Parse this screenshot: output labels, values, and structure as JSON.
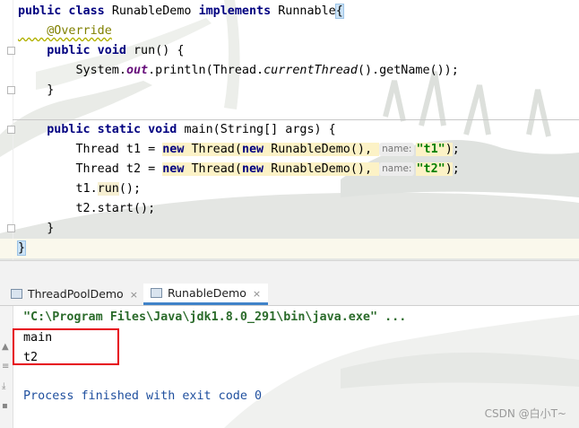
{
  "editor": {
    "lines": [
      [
        [
          "kw",
          "public class "
        ],
        [
          "txt",
          "RunableDemo "
        ],
        [
          "kw",
          "implements "
        ],
        [
          "txt",
          "Runnable"
        ],
        [
          "brace",
          "{"
        ]
      ],
      [
        [
          "ann",
          "    @Override"
        ]
      ],
      [
        [
          "kw",
          "    public void "
        ],
        [
          "txt",
          "run() {"
        ]
      ],
      [
        [
          "txt",
          "        System."
        ],
        [
          "sfield",
          "out"
        ],
        [
          "txt",
          ".println(Thread."
        ],
        [
          "scall",
          "currentThread"
        ],
        [
          "txt",
          "().getName());"
        ]
      ],
      [
        [
          "txt",
          "    }"
        ]
      ],
      [
        [
          "txt",
          ""
        ]
      ],
      [
        [
          "kw",
          "    public static void "
        ],
        [
          "txt",
          "main(String[] args) {"
        ]
      ],
      [
        [
          "txt",
          "        Thread t1 = "
        ],
        [
          "hlkw",
          "new "
        ],
        [
          "hl",
          "Thread("
        ],
        [
          "hlkw",
          "new "
        ],
        [
          "hl",
          "RunableDemo(), "
        ],
        [
          "hint",
          "name:"
        ],
        [
          "hlstr",
          "\"t1\""
        ],
        [
          "hl",
          ")"
        ],
        [
          "txt",
          ";"
        ]
      ],
      [
        [
          "txt",
          "        Thread t2 = "
        ],
        [
          "hlkw",
          "new "
        ],
        [
          "hl",
          "Thread("
        ],
        [
          "hlkw",
          "new "
        ],
        [
          "hl",
          "RunableDemo(), "
        ],
        [
          "hint",
          "name:"
        ],
        [
          "hlstr",
          "\"t2\""
        ],
        [
          "hl",
          ")"
        ],
        [
          "txt",
          ";"
        ]
      ],
      [
        [
          "txt",
          "        t1."
        ],
        [
          "hl2",
          "run"
        ],
        [
          "txt",
          "();"
        ]
      ],
      [
        [
          "txt",
          "        t2.start();"
        ]
      ],
      [
        [
          "txt",
          "    }"
        ]
      ],
      [
        [
          "brace",
          "}"
        ]
      ]
    ]
  },
  "tabs": [
    {
      "label": "ThreadPoolDemo",
      "close": "×"
    },
    {
      "label": "RunableDemo",
      "close": "×"
    }
  ],
  "console": {
    "command": "\"C:\\Program Files\\Java\\jdk1.8.0_291\\bin\\java.exe\" ...",
    "output": [
      "main",
      "t2"
    ],
    "exit_message": "Process finished with exit code 0"
  },
  "watermark": "CSDN @白小T~",
  "colors": {
    "keyword": "#000080",
    "string": "#008000",
    "annotation": "#808000",
    "highlight_box": "#e60012",
    "active_tab": "#4083c9"
  }
}
